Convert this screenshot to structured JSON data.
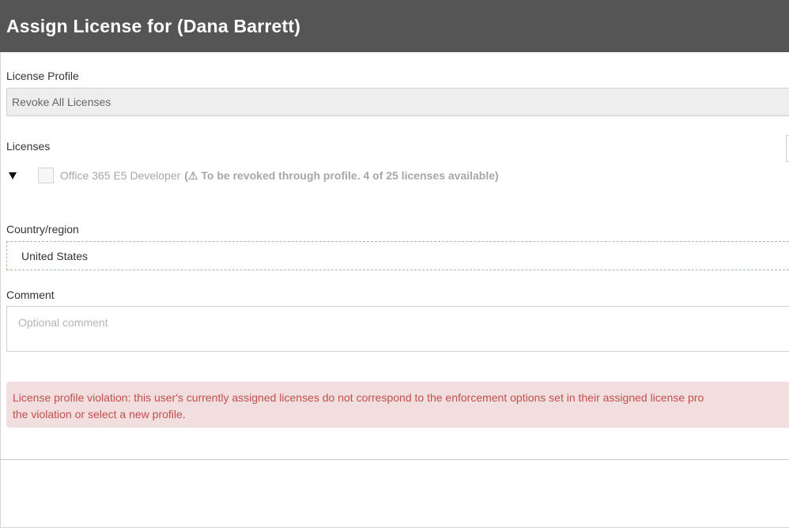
{
  "dialog": {
    "title": "Assign License for (Dana Barrett)"
  },
  "license_profile": {
    "label": "License Profile",
    "value": "Revoke All Licenses"
  },
  "licenses": {
    "label": "Licenses",
    "items": [
      {
        "name": "Office 365 E5 Developer",
        "status_prefix": "(",
        "warning_icon": "⚠",
        "status": "To be revoked through profile. 4 of 25 licenses available)",
        "checked": false
      }
    ]
  },
  "country": {
    "label": "Country/region",
    "value": "United States"
  },
  "comment": {
    "label": "Comment",
    "placeholder": "Optional comment"
  },
  "alert": {
    "line1": "License profile violation: this user's currently assigned licenses do not correspond to the enforcement options set in their assigned license pro",
    "line2": "the violation or select a new profile."
  },
  "colors": {
    "header_bg": "#555555",
    "alert_bg": "#f2dede",
    "alert_text": "#c0504d"
  }
}
